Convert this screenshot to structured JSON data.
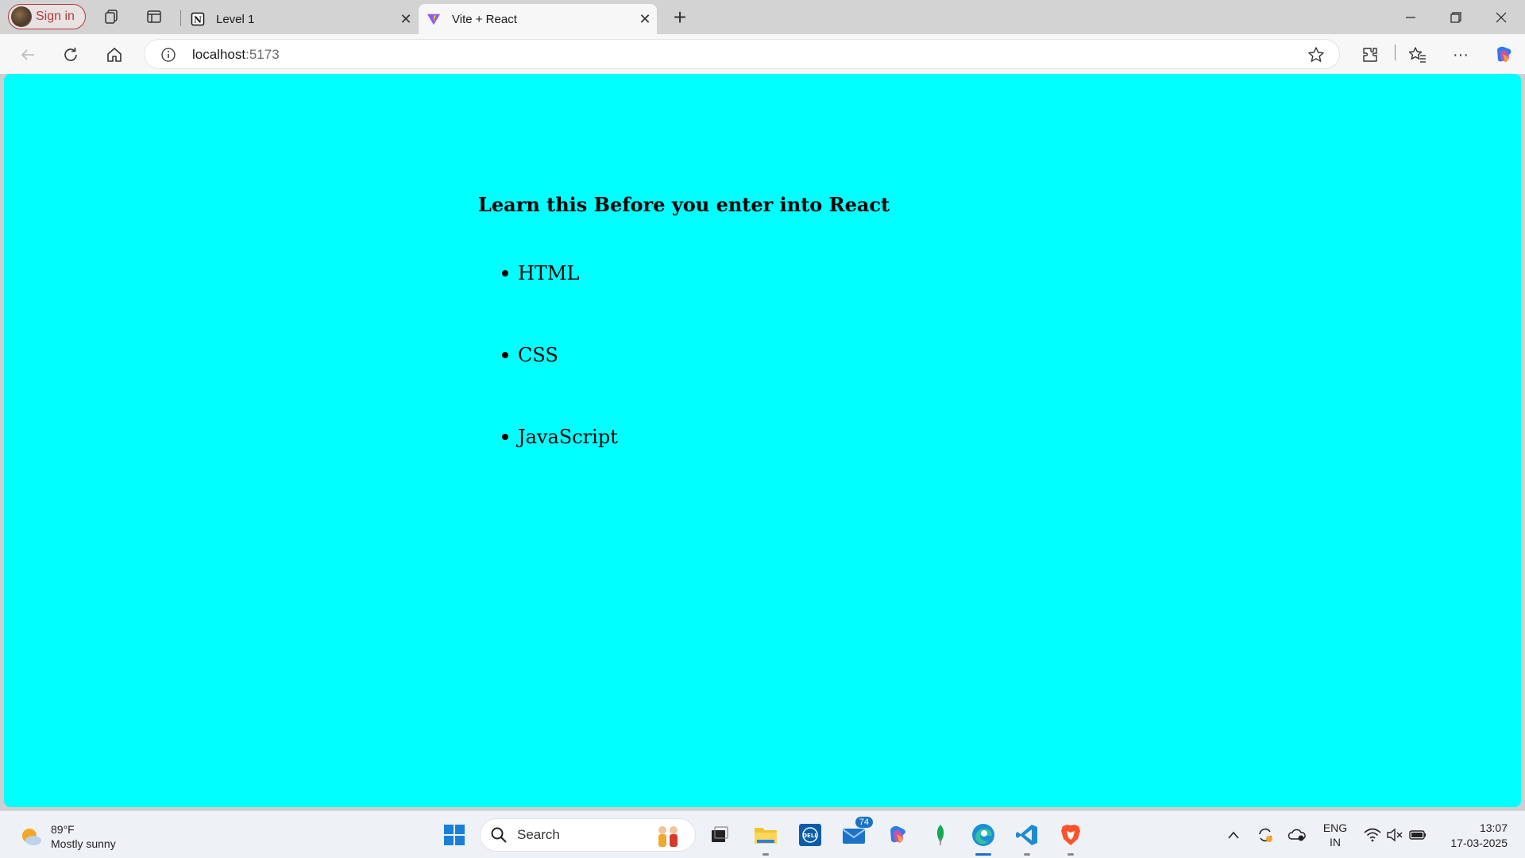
{
  "browser": {
    "signin_label": "Sign in",
    "tabs": [
      {
        "title": "Level 1",
        "favicon": "notion-icon"
      },
      {
        "title": "Vite + React",
        "favicon": "vite-icon"
      }
    ],
    "url_host": "localhost",
    "url_port": ":5173"
  },
  "page": {
    "background": "#00ffff",
    "heading": "Learn this Before you enter into React",
    "items": [
      "HTML",
      "CSS",
      "JavaScript"
    ]
  },
  "taskbar": {
    "weather_temp": "89°F",
    "weather_desc": "Mostly sunny",
    "search_label": "Search",
    "mail_badge": "74",
    "lang_top": "ENG",
    "lang_bottom": "IN",
    "time": "13:07",
    "date": "17-03-2025"
  }
}
